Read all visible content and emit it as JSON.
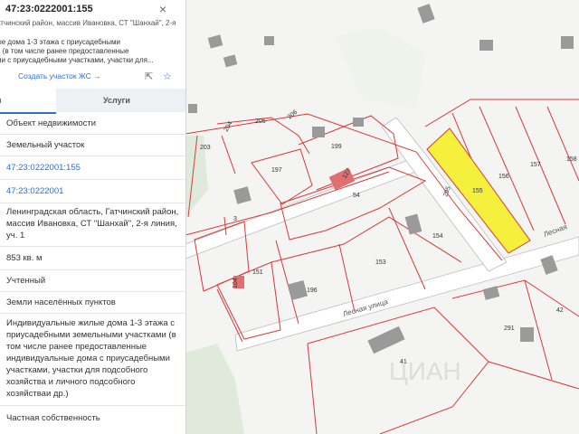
{
  "panel": {
    "title": "47:23:0222001:155",
    "close_symbol": "×",
    "address_short": "атчинский район, массив Ивановка, СТ \"Шанхай\", 2-я",
    "description_lines": [
      "ые дома 1-3 этажа с приусадебными",
      "и (в том числе ранее предоставленные",
      "ми с приусадебными участками, участки для..."
    ],
    "create_link": "Создать участок ЖС →",
    "tabs": {
      "left": "я",
      "right": "Услуги"
    },
    "rows": [
      {
        "text": "Объект недвижимости",
        "link": false
      },
      {
        "text": "Земельный участок",
        "link": false
      },
      {
        "text": "47:23:0222001:155",
        "link": true
      },
      {
        "text": "47:23:0222001",
        "link": true
      },
      {
        "text": "Ленинградская область, Гатчинский район, массив Ивановка, СТ \"Шанхай\", 2-я линия, уч. 1",
        "link": false
      },
      {
        "text": "853 кв. м",
        "link": false
      },
      {
        "text": "Учтенный",
        "link": false
      },
      {
        "text": "Земли населённых пунктов",
        "link": false
      },
      {
        "text": "Индивидуальные жилые дома 1-3 этажа с приусадебными земельными участками (в том числе ранее предоставленные индивидуальные дома с приусадебными участками, участки для подсобного хозяйства и личного подсобного хозяйстваи др.)",
        "link": false
      },
      {
        "text": "Частная собственность",
        "link": false
      }
    ]
  },
  "map": {
    "parcel_labels": [
      "204",
      "205",
      "206",
      "203",
      "199",
      "197",
      "127",
      "54",
      "3",
      "295",
      "155",
      "156",
      "157",
      "158",
      "154",
      "153",
      "151",
      "104",
      "196",
      "291",
      "42",
      "41"
    ],
    "street_labels": [
      "Лесная улица",
      "Лесная"
    ],
    "watermark": "ЦИАН",
    "colors": {
      "boundary": "#d63a3a",
      "selected_fill": "#f4f03b",
      "house_fill": "#e07070",
      "green": "#dfe9dc"
    }
  }
}
